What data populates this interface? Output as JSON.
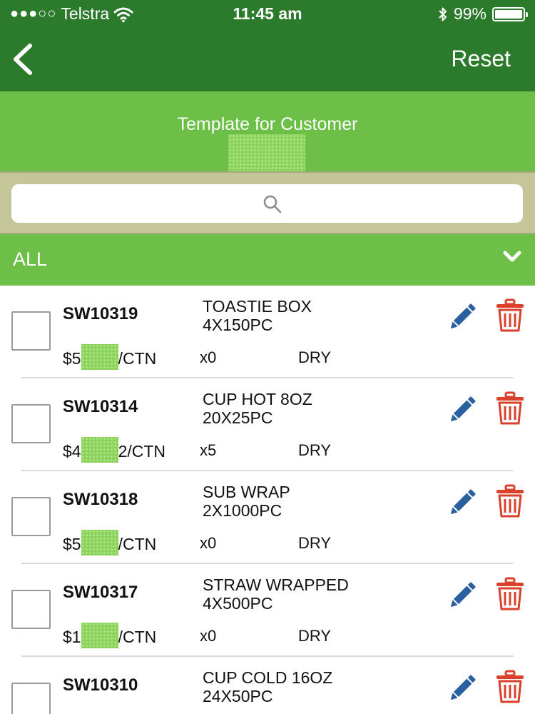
{
  "status_bar": {
    "signal": "●●●○○",
    "carrier": "Telstra",
    "time": "11:45 am",
    "battery": "99%",
    "battery_level": 0.99
  },
  "nav": {
    "reset_label": "Reset"
  },
  "template": {
    "title": "Template for Customer"
  },
  "filter": {
    "selected": "ALL"
  },
  "colors": {
    "nav_green": "#2c7a2c",
    "band_green": "#6cbf47",
    "search_band": "#c5c697",
    "edit_blue": "#2a5fa0",
    "delete_red": "#d9412b"
  },
  "icons": {
    "back": "chevron-left-icon",
    "search": "magnifier-icon",
    "filter": "chevron-down-icon",
    "edit": "pencil-icon",
    "delete": "trash-icon"
  },
  "items": [
    {
      "code": "SW10319",
      "price_prefix": "$5",
      "price_suffix": "/CTN",
      "description_line1": "TOASTIE BOX",
      "description_line2": "4X150PC",
      "quantity": "x0",
      "storage": "DRY"
    },
    {
      "code": "SW10314",
      "price_prefix": "$4",
      "price_suffix": "2/CTN",
      "description_line1": "CUP HOT 8OZ",
      "description_line2": "20X25PC",
      "quantity": "x5",
      "storage": "DRY"
    },
    {
      "code": "SW10318",
      "price_prefix": "$5",
      "price_suffix": "/CTN",
      "description_line1": "SUB WRAP",
      "description_line2": "2X1000PC",
      "quantity": "x0",
      "storage": "DRY"
    },
    {
      "code": "SW10317",
      "price_prefix": "$1",
      "price_suffix": "/CTN",
      "description_line1": "STRAW WRAPPED",
      "description_line2": "4X500PC",
      "quantity": "x0",
      "storage": "DRY"
    },
    {
      "code": "SW10310",
      "price_prefix": "",
      "price_suffix": "",
      "description_line1": "CUP COLD 16OZ",
      "description_line2": "24X50PC",
      "quantity": "",
      "storage": ""
    }
  ]
}
